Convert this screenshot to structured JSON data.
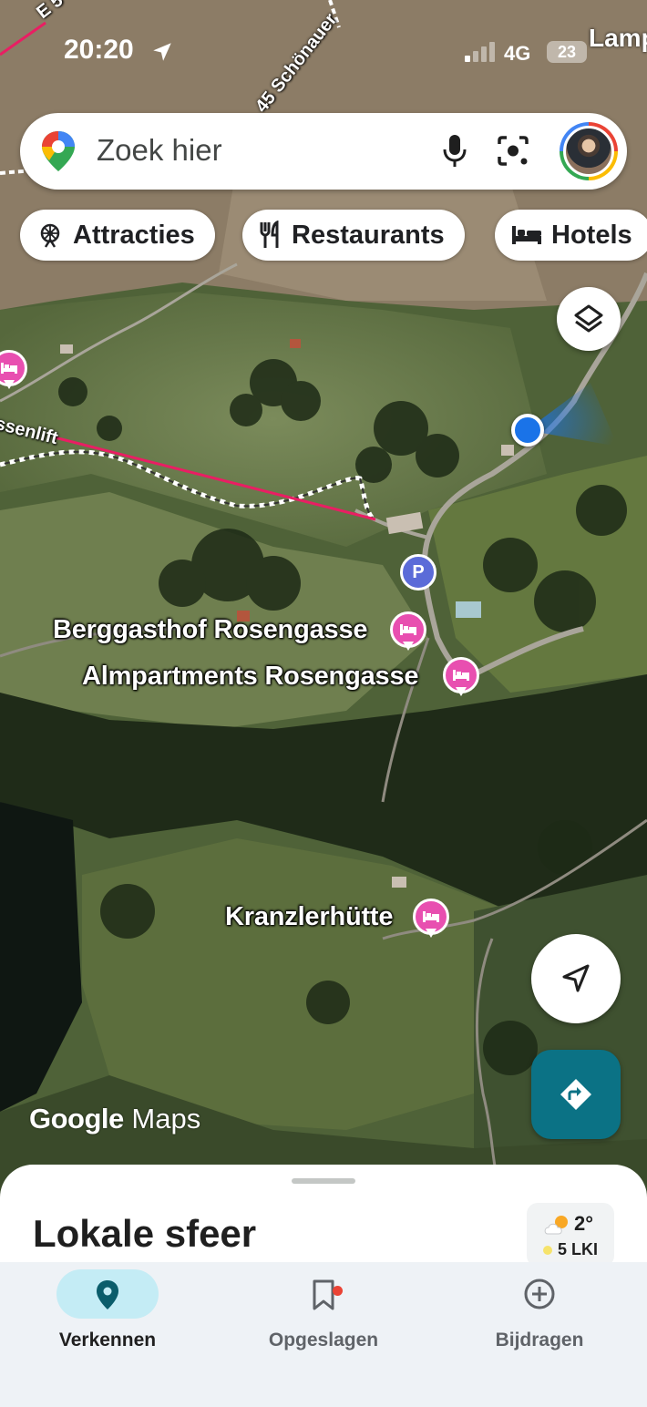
{
  "status_bar": {
    "time": "20:20",
    "network": "4G",
    "battery": "23",
    "overflow_label": "Lamp"
  },
  "search": {
    "placeholder": "Zoek hier",
    "icons": [
      "maps-pin-icon",
      "microphone-icon",
      "lens-icon",
      "avatar"
    ]
  },
  "chips": [
    {
      "label": "Attracties",
      "icon": "ferris-wheel-icon"
    },
    {
      "label": "Restaurants",
      "icon": "fork-knife-icon"
    },
    {
      "label": "Hotels",
      "icon": "bed-icon"
    }
  ],
  "map": {
    "road_labels": [
      "E 5",
      "45 Schönauer",
      "ssenlift"
    ],
    "places": [
      {
        "label": "Berggasthof Rosengasse",
        "icon": "hotel-icon"
      },
      {
        "label": "Almpartments Rosengasse",
        "icon": "hotel-icon"
      },
      {
        "label": "Kranzlerhütte",
        "icon": "hotel-icon"
      }
    ],
    "parking_label": "P",
    "attribution": {
      "google": "Google",
      "maps": "Maps"
    },
    "colors": {
      "hotel_pin": "#e84fb0",
      "parking_pin": "#5b6bd8",
      "my_location": "#1a73e8",
      "lift_line": "#e91e63"
    }
  },
  "sheet": {
    "title": "Lokale sfeer",
    "weather": {
      "temp": "2°",
      "aqi": "5 LKI"
    }
  },
  "nav": {
    "items": [
      {
        "label": "Verkennen",
        "icon": "explore-pin-icon",
        "active": true
      },
      {
        "label": "Opgeslagen",
        "icon": "bookmark-icon",
        "active": false
      },
      {
        "label": "Bijdragen",
        "icon": "add-circle-icon",
        "active": false
      }
    ],
    "accent": "#0b7285"
  }
}
